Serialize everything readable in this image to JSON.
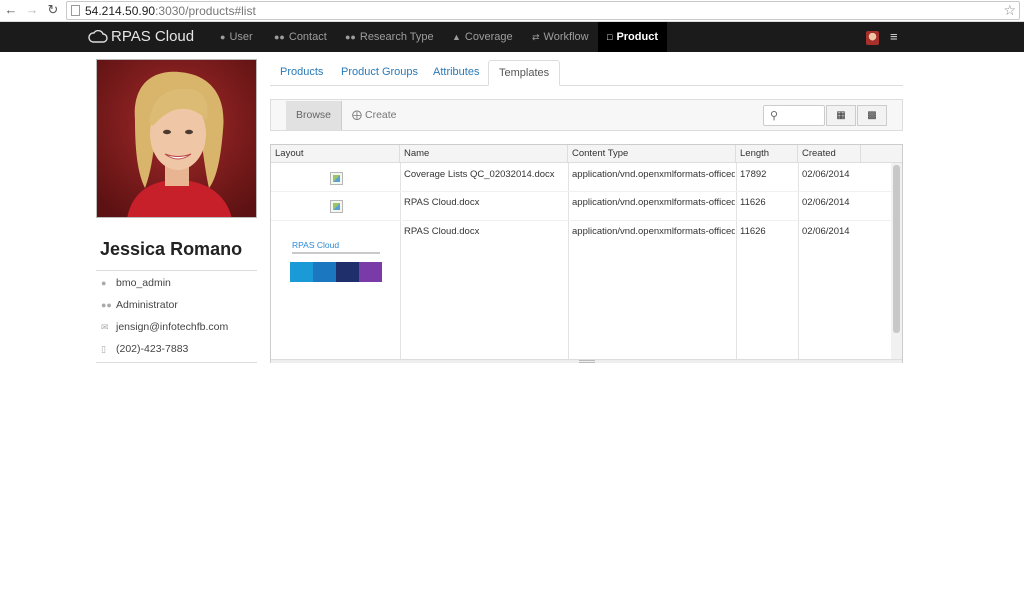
{
  "browser": {
    "url_host": "54.214.50.90",
    "url_path": ":3030/products#list"
  },
  "navbar": {
    "brand": "RPAS Cloud",
    "items": [
      {
        "label": "User",
        "icon": "user-icon"
      },
      {
        "label": "Contact",
        "icon": "users-icon"
      },
      {
        "label": "Research Type",
        "icon": "users-icon"
      },
      {
        "label": "Coverage",
        "icon": "sitemap-icon"
      },
      {
        "label": "Workflow",
        "icon": "exchange-icon"
      },
      {
        "label": "Product",
        "icon": "file-icon",
        "active": true
      }
    ]
  },
  "profile": {
    "name": "Jessica Romano",
    "username": "bmo_admin",
    "role": "Administrator",
    "email": "jensign@infotechfb.com",
    "phone": "(202)-423-7883"
  },
  "tabs": [
    {
      "label": "Products"
    },
    {
      "label": "Product Groups"
    },
    {
      "label": "Attributes"
    },
    {
      "label": "Templates",
      "active": true
    }
  ],
  "toolbar": {
    "browse_label": "Browse",
    "create_label": "Create"
  },
  "grid": {
    "columns": [
      "Layout",
      "Name",
      "Content Type",
      "Length",
      "Created"
    ],
    "rows": [
      {
        "name": "Coverage Lists QC_02032014.docx",
        "content_type": "application/vnd.openxmlformats-officedocument",
        "length": "17892",
        "created": "02/06/2014"
      },
      {
        "name": "RPAS Cloud.docx",
        "content_type": "application/vnd.openxmlformats-officedocument",
        "length": "11626",
        "created": "02/06/2014"
      },
      {
        "name": "RPAS Cloud.docx",
        "content_type": "application/vnd.openxmlformats-officedocument",
        "length": "11626",
        "created": "02/06/2014"
      }
    ],
    "preview_title": "RPAS Cloud"
  },
  "colors": {
    "navbar_bg": "#1b1b1b",
    "link": "#2a7ab8",
    "tile_blue": "#1a9bd7",
    "tile_mid_blue": "#1b78c0",
    "tile_navy": "#1f2f6b",
    "tile_purple": "#7a3aa8"
  }
}
